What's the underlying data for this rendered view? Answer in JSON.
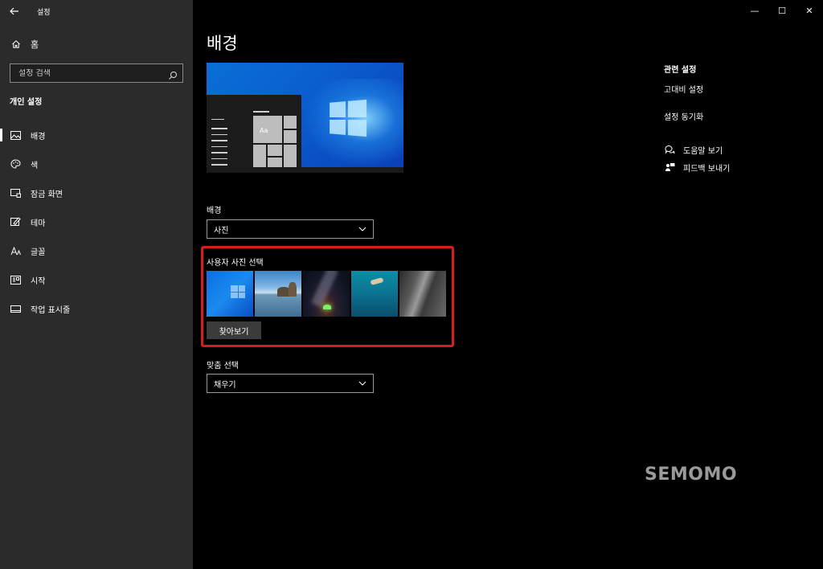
{
  "window": {
    "app_title": "설정",
    "back": "←",
    "minimize": "—",
    "maximize": "☐",
    "close": "✕"
  },
  "sidebar": {
    "home_label": "홈",
    "search_placeholder": "설정 검색",
    "section_title": "개인 설정",
    "items": [
      {
        "label": "배경",
        "icon": "picture-icon",
        "active": true
      },
      {
        "label": "색",
        "icon": "palette-icon"
      },
      {
        "label": "잠금 화면",
        "icon": "lock-screen-icon"
      },
      {
        "label": "테마",
        "icon": "theme-icon"
      },
      {
        "label": "글꼴",
        "icon": "font-icon"
      },
      {
        "label": "시작",
        "icon": "start-icon"
      },
      {
        "label": "작업 표시줄",
        "icon": "taskbar-icon"
      }
    ]
  },
  "main": {
    "title": "배경",
    "preview_tile_text": "Aa",
    "background_label": "배경",
    "background_value": "사진",
    "choose_picture_label": "사용자 사진 선택",
    "browse_label": "찾아보기",
    "fit_label": "맞춤 선택",
    "fit_value": "채우기"
  },
  "related": {
    "title": "관련 설정",
    "links": [
      "고대비 설정",
      "설정 동기화"
    ]
  },
  "help": {
    "get_help": "도움말 보기",
    "feedback": "피드백 보내기"
  },
  "watermark": "SEMOMO",
  "colors": {
    "sidebar_bg": "#2b2b2b",
    "main_bg": "#000000",
    "highlight": "#d41c22"
  }
}
